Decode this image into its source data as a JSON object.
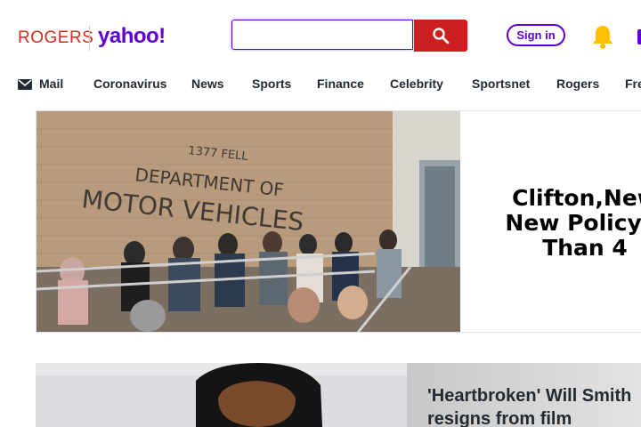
{
  "brand": {
    "rogers": "ROGERS",
    "yahoo": "yahoo!"
  },
  "search": {
    "placeholder": "",
    "value": ""
  },
  "header": {
    "signin_label": "Sign in"
  },
  "nav": {
    "items": [
      "Mail",
      "Coronavirus",
      "News",
      "Sports",
      "Finance",
      "Celebrity",
      "Sportsnet",
      "Rogers",
      "Fre"
    ]
  },
  "hero": {
    "sign_line1": "1377 FELL",
    "sign_line2": "DEPARTMENT OF",
    "sign_line3": "MOTOR VEHICLES",
    "title_line1": "Clifton,New",
    "title_line2": "New Policy F",
    "title_line3": "Than 4"
  },
  "story2": {
    "title_line1": "'Heartbroken' Will Smith",
    "title_line2": "resigns from film"
  },
  "colors": {
    "yahoo_purple": "#6001d2",
    "rogers_red": "#da291c",
    "search_red": "#cc1f1f",
    "bell_yellow": "#ffbe00"
  }
}
